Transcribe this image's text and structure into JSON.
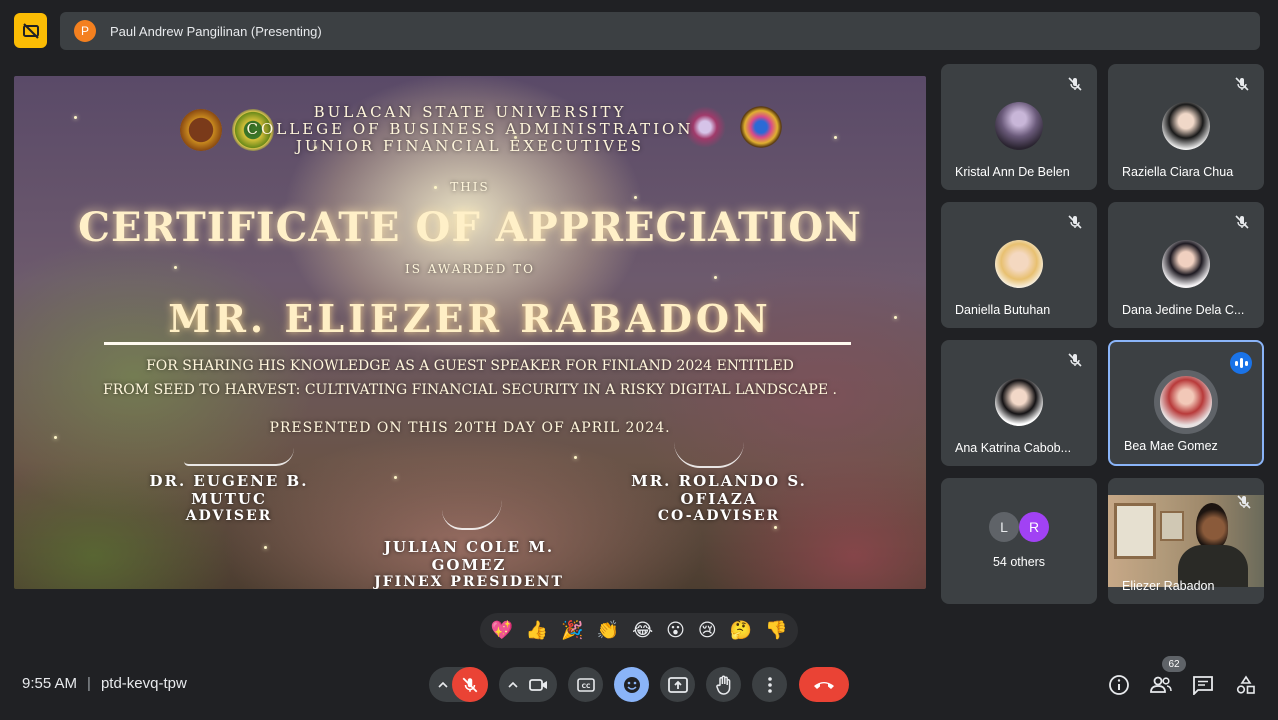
{
  "header": {
    "presenter_initial": "P",
    "presenter_label": "Paul Andrew Pangilinan (Presenting)"
  },
  "certificate": {
    "university": "BULACAN STATE UNIVERSITY",
    "college": "COLLEGE OF BUSINESS ADMINISTRATION",
    "org": "JUNIOR FINANCIAL EXECUTIVES",
    "this": "THIS",
    "title": "CERTIFICATE OF APPRECIATION",
    "awarded": "IS AWARDED TO",
    "recipient": "MR. ELIEZER RABADON",
    "desc1": "FOR SHARING HIS KNOWLEDGE AS A GUEST SPEAKER FOR FINLAND 2024 ENTITLED",
    "desc2": "FROM SEED TO HARVEST: CULTIVATING FINANCIAL SECURITY IN A RISKY DIGITAL LANDSCAPE .",
    "presented": "PRESENTED ON THIS 20TH DAY OF APRIL 2024.",
    "sig1_name": "DR. EUGENE B. MUTUC",
    "sig1_role": "ADVISER",
    "sig2_name": "MR. ROLANDO S. OFIAZA",
    "sig2_role": "CO-ADVISER",
    "sig3_name": "JULIAN COLE M. GOMEZ",
    "sig3_role": "JFINEX PRESIDENT"
  },
  "participants": [
    {
      "name": "Kristal Ann De Belen",
      "muted": true
    },
    {
      "name": "Raziella Ciara Chua",
      "muted": true
    },
    {
      "name": "Daniella Butuhan",
      "muted": true
    },
    {
      "name": "Dana Jedine Dela C...",
      "muted": true
    },
    {
      "name": "Ana Katrina Cabob...",
      "muted": true
    },
    {
      "name": "Bea Mae Gomez",
      "muted": false,
      "speaking": true
    }
  ],
  "others": {
    "initials": [
      "L",
      "R"
    ],
    "label": "54 others"
  },
  "self_tile": {
    "name": "Eliezer Rabadon"
  },
  "reactions": [
    "💖",
    "👍",
    "🎉",
    "👏",
    "😂",
    "😮",
    "😢",
    "🤔",
    "👎"
  ],
  "footer": {
    "time": "9:55 AM",
    "separator": "|",
    "meeting_code": "ptd-kevq-tpw",
    "people_count": "62"
  },
  "colors": {
    "background": "#202124",
    "tile": "#3c4043",
    "accent_yellow": "#fbbc04",
    "mic_off_red": "#ea4335",
    "emoji_blue": "#8ab4f8",
    "active_border": "#8ab4f8"
  }
}
